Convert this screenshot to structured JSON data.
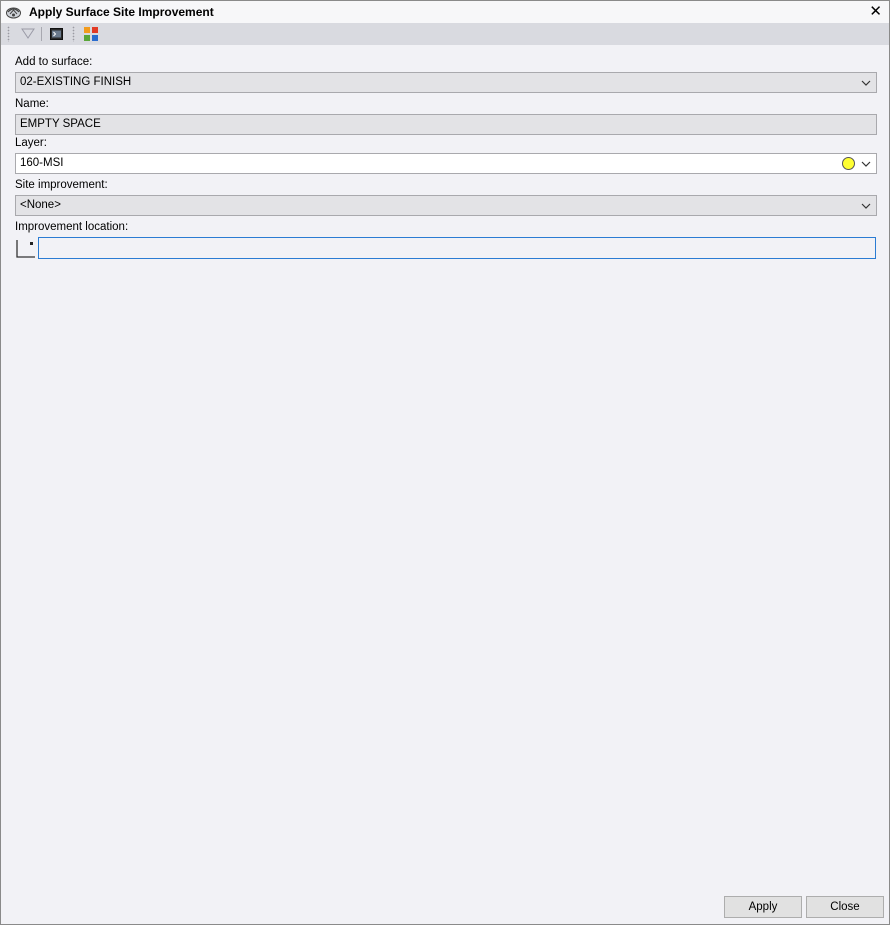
{
  "window": {
    "title": "Apply Surface Site Improvement",
    "close_symbol": "✕"
  },
  "toolbar": {
    "items": [
      {
        "name": "filter-icon"
      },
      {
        "name": "command-prompt-icon"
      },
      {
        "name": "color-palette-icon"
      }
    ]
  },
  "form": {
    "surface": {
      "label": "Add to surface:",
      "value": "02-EXISTING FINISH"
    },
    "name": {
      "label": "Name:",
      "value": "EMPTY SPACE"
    },
    "layer": {
      "label": "Layer:",
      "value": "160-MSI",
      "color": "#ffff33"
    },
    "site_improvement": {
      "label": "Site improvement:",
      "value": "<None>"
    },
    "location": {
      "label": "Improvement location:",
      "value": ""
    }
  },
  "buttons": {
    "apply": "Apply",
    "close": "Close"
  },
  "colors": {
    "accent": "#2b7cd3",
    "window_bg": "#f2f2f6",
    "toolbar_bg": "#d9dae0"
  }
}
